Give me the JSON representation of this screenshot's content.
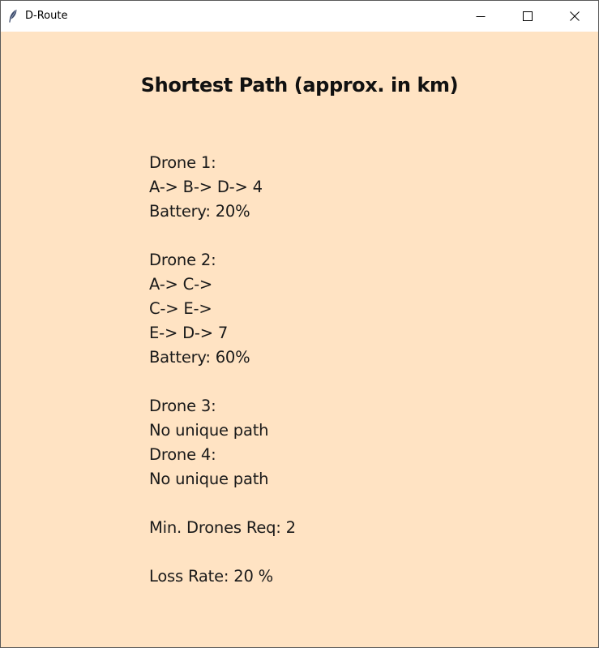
{
  "window": {
    "title": "D-Route",
    "icons": {
      "app": "feather-icon",
      "minimize": "minimize-icon",
      "maximize": "maximize-icon",
      "close": "close-icon"
    }
  },
  "heading": "Shortest Path (approx. in km)",
  "results": {
    "drone1": {
      "label": "Drone 1:",
      "path": [
        "A-> B-> D-> 4"
      ],
      "battery": "Battery: 20%"
    },
    "drone2": {
      "label": "Drone 2:",
      "path": [
        "A-> C->",
        "C-> E->",
        "E-> D-> 7"
      ],
      "battery": "Battery: 60%"
    },
    "drone3": {
      "label": "Drone 3:",
      "status": "No unique path"
    },
    "drone4": {
      "label": "Drone 4:",
      "status": "No unique path"
    },
    "min_drones": "Min. Drones Req: 2",
    "loss_rate": "Loss Rate: 20 %"
  },
  "colors": {
    "background": "#FFE3C3",
    "titlebar": "#FFFFFF",
    "text": "#1A1A1A"
  }
}
